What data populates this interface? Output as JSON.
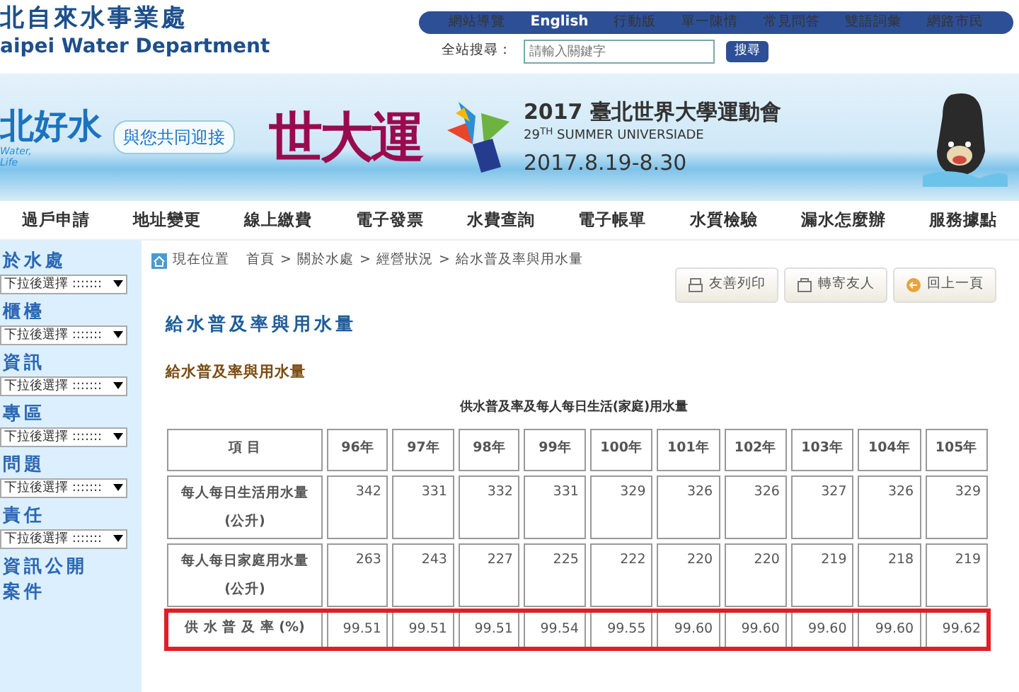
{
  "header": {
    "logo_title": "北自來水事業處",
    "logo_subtitle": "aipei Water Department",
    "top_links": [
      "網站導覽",
      "English",
      "行動版",
      "單一陳情",
      "常見問答",
      "雙語詞彙",
      "網路市民"
    ],
    "search": {
      "label": "全站搜尋：",
      "placeholder": "請輸入關鍵字",
      "button": "搜尋"
    }
  },
  "banner": {
    "slogan": "北好水",
    "slogan_sub": [
      "Water,",
      "Life"
    ],
    "tagline": "與您共同迎接",
    "event_short": "世大運",
    "event_title": "2017 臺北世界大學運動會",
    "event_subtitle": "29$^{TH}$ SUMMER UNIVERSIADE",
    "dates": "2017.8.19-8.30"
  },
  "nav": [
    "過戶申請",
    "地址變更",
    "線上繳費",
    "電子發票",
    "水費查詢",
    "電子帳單",
    "水質檢驗",
    "漏水怎麼辦",
    "服務據點"
  ],
  "sidebar": [
    {
      "kind": "heading",
      "label": "於水處"
    },
    {
      "kind": "select",
      "value": "下拉後選擇 :::::::"
    },
    {
      "kind": "heading",
      "label": "櫃檯"
    },
    {
      "kind": "select",
      "value": "下拉後選擇 :::::::"
    },
    {
      "kind": "heading",
      "label": "資訊"
    },
    {
      "kind": "select",
      "value": "下拉後選擇 :::::::"
    },
    {
      "kind": "heading",
      "label": "專區"
    },
    {
      "kind": "select",
      "value": "下拉後選擇 :::::::"
    },
    {
      "kind": "heading",
      "label": "問題"
    },
    {
      "kind": "select",
      "value": "下拉後選擇 :::::::"
    },
    {
      "kind": "heading",
      "label": "責任"
    },
    {
      "kind": "select",
      "value": "下拉後選擇 :::::::"
    },
    {
      "kind": "heading",
      "label": "資訊公開"
    },
    {
      "kind": "heading",
      "label": "案件"
    }
  ],
  "breadcrumb": {
    "label": "現在位置",
    "separator": ">",
    "items": [
      "首頁",
      "關於水處",
      "經營狀況",
      "給水普及率與用水量"
    ]
  },
  "actions": [
    {
      "kind": "print",
      "label": "友善列印"
    },
    {
      "kind": "forward",
      "label": "轉寄友人"
    },
    {
      "kind": "back",
      "label": "回上一頁"
    }
  ],
  "page_title": "給水普及率與用水量",
  "section_title": "給水普及率與用水量",
  "table": {
    "caption": "供水普及率及每人每日生活(家庭)用水量",
    "columns": [
      "項 目",
      "96年",
      "97年",
      "98年",
      "99年",
      "100年",
      "101年",
      "102年",
      "103年",
      "104年",
      "105年"
    ],
    "rows": [
      {
        "label": "每人每日生活用水量",
        "unit": "(公升)",
        "highlighted": false,
        "values": [
          "342",
          "331",
          "332",
          "331",
          "329",
          "326",
          "326",
          "327",
          "326",
          "329"
        ]
      },
      {
        "label": "每人每日家庭用水量",
        "unit": "(公升)",
        "highlighted": false,
        "values": [
          "263",
          "243",
          "227",
          "225",
          "222",
          "220",
          "220",
          "219",
          "218",
          "219"
        ]
      },
      {
        "label": "供 水 普 及 率 (%)",
        "highlighted": true,
        "values": [
          "99.51",
          "99.51",
          "99.51",
          "99.54",
          "99.55",
          "99.60",
          "99.60",
          "99.60",
          "99.60",
          "99.62"
        ]
      }
    ]
  }
}
